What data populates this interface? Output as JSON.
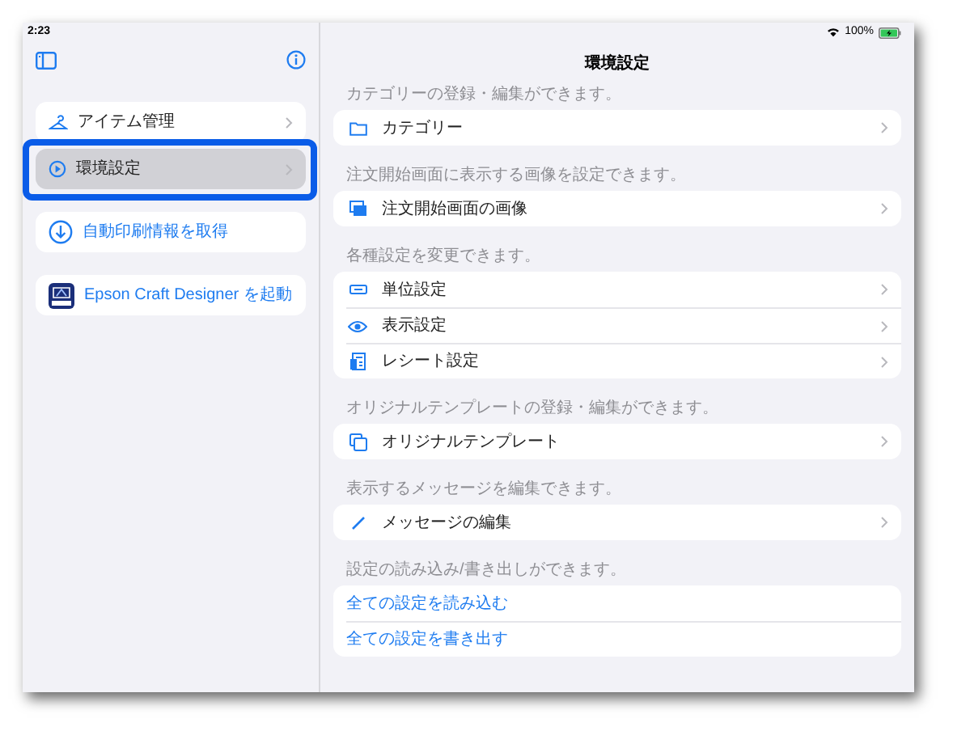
{
  "status_bar": {
    "time": "2:23",
    "battery": "100%"
  },
  "sidebar": {
    "items": [
      {
        "label": "アイテム管理",
        "selected": false,
        "kind": "nav"
      },
      {
        "label": "環境設定",
        "selected": true,
        "kind": "nav"
      },
      {
        "label": "自動印刷情報を取得",
        "selected": false,
        "kind": "action"
      },
      {
        "label": "Epson Craft Designer を起動",
        "selected": false,
        "kind": "app"
      }
    ]
  },
  "main": {
    "title": "環境設定",
    "sections": [
      {
        "caption": "カテゴリーの登録・編集ができます。",
        "rows": [
          {
            "label": "カテゴリー",
            "kind": "nav"
          }
        ]
      },
      {
        "caption": "注文開始画面に表示する画像を設定できます。",
        "rows": [
          {
            "label": "注文開始画面の画像",
            "kind": "nav"
          }
        ]
      },
      {
        "caption": "各種設定を変更できます。",
        "rows": [
          {
            "label": "単位設定",
            "kind": "nav"
          },
          {
            "label": "表示設定",
            "kind": "nav"
          },
          {
            "label": "レシート設定",
            "kind": "nav"
          }
        ]
      },
      {
        "caption": "オリジナルテンプレートの登録・編集ができます。",
        "rows": [
          {
            "label": "オリジナルテンプレート",
            "kind": "nav"
          }
        ]
      },
      {
        "caption": "表示するメッセージを編集できます。",
        "rows": [
          {
            "label": "メッセージの編集",
            "kind": "nav"
          }
        ]
      },
      {
        "caption": "設定の読み込み/書き出しができます。",
        "rows": [
          {
            "label": "全ての設定を読み込む",
            "kind": "action"
          },
          {
            "label": "全ての設定を書き出す",
            "kind": "action"
          }
        ]
      }
    ]
  }
}
